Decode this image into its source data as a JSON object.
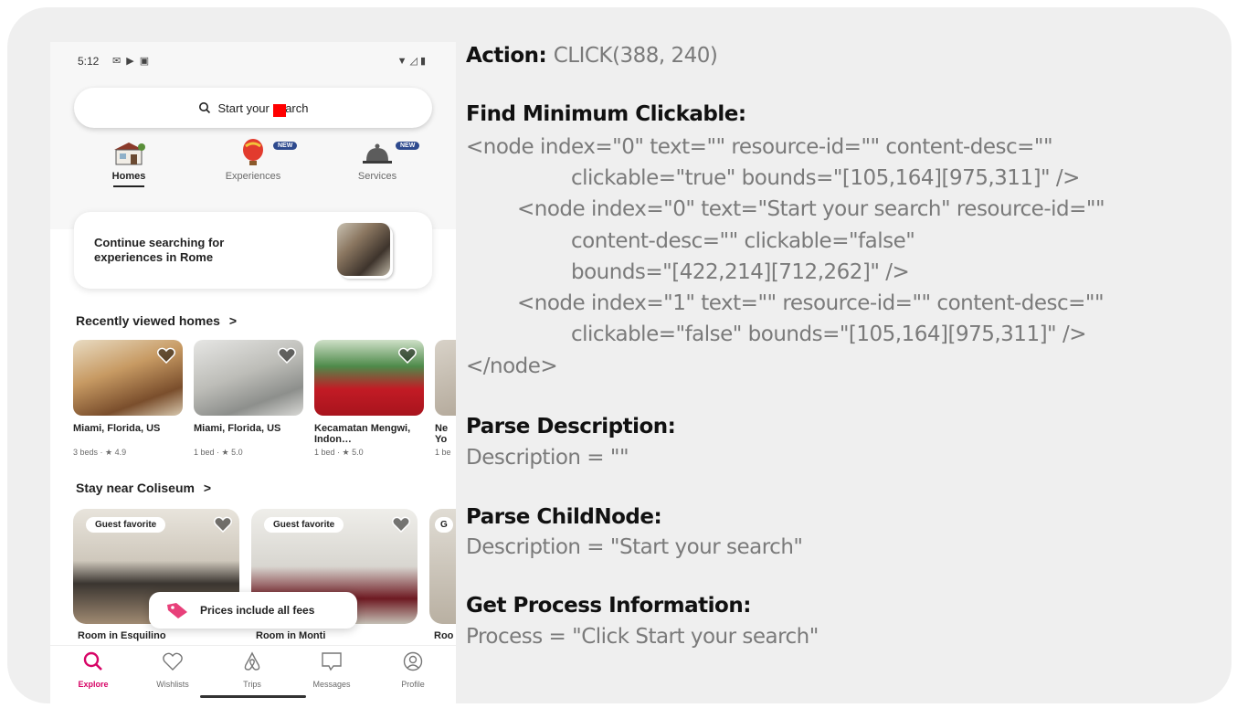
{
  "phone": {
    "status": {
      "time": "5:12",
      "left_icons": [
        "mail-icon",
        "play-icon",
        "image-icon"
      ],
      "right_icons": [
        "wifi-icon",
        "signal-icon",
        "battery-icon"
      ]
    },
    "search": {
      "label": "Start your search"
    },
    "top_tabs": [
      {
        "label": "Homes",
        "icon": "house-icon",
        "active": true,
        "badge": ""
      },
      {
        "label": "Experiences",
        "icon": "balloon-icon",
        "active": false,
        "badge": "NEW"
      },
      {
        "label": "Services",
        "icon": "bell-icon",
        "active": false,
        "badge": "NEW"
      }
    ],
    "continue_card": {
      "text": "Continue searching for experiences in Rome"
    },
    "recent": {
      "title": "Recently viewed homes",
      "chevron": ">",
      "items": [
        {
          "name": "Miami, Florida, US",
          "meta": "3 beds · ★ 4.9"
        },
        {
          "name": "Miami, Florida, US",
          "meta": "1 bed · ★ 5.0"
        },
        {
          "name": "Kecamatan Mengwi, Indon…",
          "meta": "1 bed · ★ 5.0"
        },
        {
          "name": "Ne Yo",
          "meta": "1 be"
        }
      ]
    },
    "stay": {
      "title": "Stay near Coliseum",
      "chevron": ">",
      "items": [
        {
          "name": "Room in Esquilino",
          "badge": "Guest favorite"
        },
        {
          "name": "Room in Monti",
          "badge": "Guest favorite"
        },
        {
          "name": "Roo",
          "badge": "G"
        }
      ]
    },
    "prices_note": "Prices include all fees",
    "nav": [
      {
        "label": "Explore",
        "icon": "search-icon",
        "active": true
      },
      {
        "label": "Wishlists",
        "icon": "heart-icon",
        "active": false
      },
      {
        "label": "Trips",
        "icon": "airbnb-icon",
        "active": false
      },
      {
        "label": "Messages",
        "icon": "message-icon",
        "active": false
      },
      {
        "label": "Profile",
        "icon": "profile-icon",
        "active": false
      }
    ],
    "colors": {
      "accent": "#d70466",
      "badge": "#2e4a8e"
    }
  },
  "panel": {
    "action": {
      "label": "Action:",
      "value": "CLICK(388, 240)"
    },
    "find": {
      "label": "Find Minimum Clickable:",
      "lines": [
        "<node index=\"0\" text=\"\" resource-id=\"\" content-desc=\"\"",
        "clickable=\"true\" bounds=\"[105,164][975,311]\"  />",
        "<node index=\"0\" text=\"Start your search\" resource-id=\"\"",
        "content-desc=\"\" clickable=\"false\"",
        "bounds=\"[422,214][712,262]\" />",
        "<node index=\"1\" text=\"\" resource-id=\"\" content-desc=\"\"",
        "clickable=\"false\" bounds=\"[105,164][975,311]\" />",
        "</node>"
      ]
    },
    "parse_desc": {
      "label": "Parse Description:",
      "value": "Description = \"\""
    },
    "parse_child": {
      "label": "Parse ChildNode:",
      "value": "Description = \"Start your search\""
    },
    "process": {
      "label": "Get Process Information:",
      "value": "Process = \"Click Start your search\""
    }
  }
}
